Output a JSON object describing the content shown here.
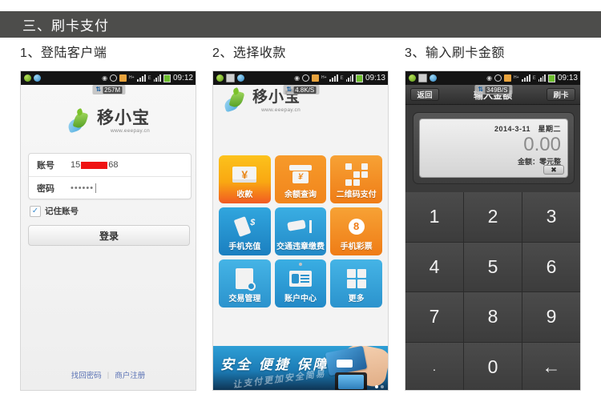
{
  "section": {
    "title": "三、刷卡支付"
  },
  "steps": [
    {
      "caption": "1、登陆客户端"
    },
    {
      "caption": "2、选择收款"
    },
    {
      "caption": "3、输入刷卡金额"
    }
  ],
  "screen1": {
    "statusbar": {
      "time": "09:12",
      "hsdpa": "H+",
      "edge": "E"
    },
    "speed_badge": {
      "value": "257M",
      "arrows": "⇅"
    },
    "brand": {
      "name": "移小宝",
      "url": "www.eeepay.cn"
    },
    "form": {
      "account_label": "账号",
      "account_prefix": "15",
      "account_suffix": "68",
      "password_label": "密码",
      "password_masked": "••••••"
    },
    "remember": {
      "label": "记住账号",
      "checked_glyph": "✓"
    },
    "login_button": "登录",
    "links": {
      "forgot": "找回密码",
      "separator": "|",
      "register": "商户注册"
    }
  },
  "screen2": {
    "statusbar": {
      "time": "09:13",
      "hsdpa": "H+",
      "edge": "E"
    },
    "speed_badge": {
      "value": "4.8K/S",
      "arrows": "⇅"
    },
    "brand": {
      "name": "移小宝",
      "url": "www.eeepay.cn"
    },
    "tiles": [
      {
        "label": "收款",
        "icon": "cash-receive-icon",
        "glyph": "¥",
        "color": "#fcc21c"
      },
      {
        "label": "余额查询",
        "icon": "atm-balance-icon",
        "glyph": "¥",
        "color": "#f1851c"
      },
      {
        "label": "二维码支付",
        "icon": "qrcode-icon",
        "glyph": "",
        "color": "#ef7c16"
      },
      {
        "label": "手机充值",
        "icon": "mobile-topup-icon",
        "glyph": "$",
        "color": "#1b7fc0"
      },
      {
        "label": "交通违章缴费",
        "icon": "traffic-camera-icon",
        "glyph": "",
        "color": "#2289c7"
      },
      {
        "label": "手机彩票",
        "icon": "lottery-ball-icon",
        "glyph": "8",
        "color": "#ef7c16"
      },
      {
        "label": "交易管理",
        "icon": "transaction-search-icon",
        "glyph": "",
        "color": "#2b93cd"
      },
      {
        "label": "账户中心",
        "icon": "account-card-icon",
        "glyph": "",
        "color": "#2289c7"
      },
      {
        "label": "更多",
        "icon": "more-grid-icon",
        "glyph": "",
        "color": "#2b93cd"
      }
    ],
    "banner": {
      "headline": "安全 便捷 保障",
      "subline": "让支付更加安全简易"
    }
  },
  "screen3": {
    "statusbar": {
      "time": "09:13",
      "hsdpa": "H+",
      "edge": "E"
    },
    "speed_badge": {
      "value": "349B/S",
      "arrows": "⇅"
    },
    "topbar": {
      "back": "返回",
      "title": "输入金额",
      "action": "刷卡"
    },
    "display": {
      "date": "2014-3-11　星期二",
      "amount": "0.00",
      "note": "金额：零元整",
      "clear_glyph": "✖"
    },
    "keys": [
      "1",
      "2",
      "3",
      "4",
      "5",
      "6",
      "7",
      "8",
      "9",
      ".",
      "0",
      "←"
    ]
  },
  "colors": {
    "section_bar": "#4d4d4b",
    "accent_blue": "#2b93cd",
    "accent_orange": "#ef7c16",
    "redaction": "#ef1313"
  }
}
